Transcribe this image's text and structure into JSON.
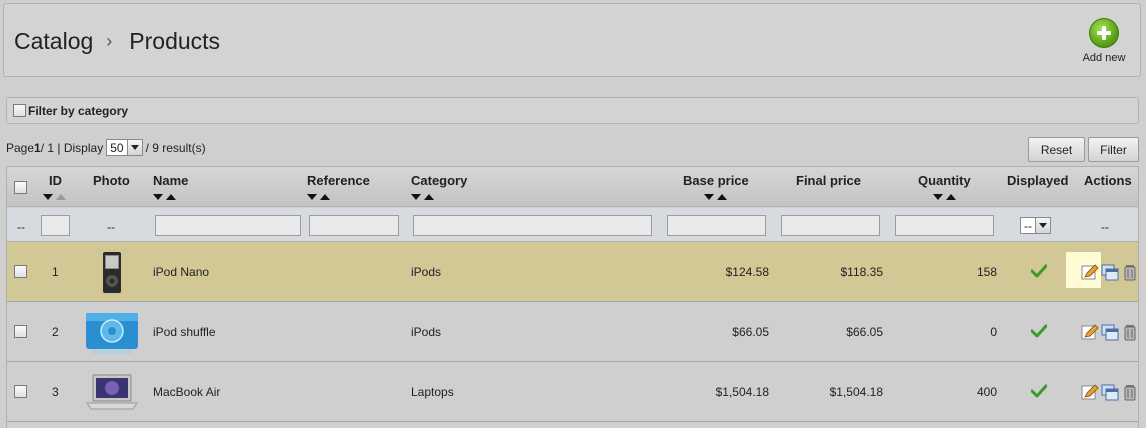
{
  "breadcrumb": {
    "root": "Catalog",
    "separator": "›",
    "current": "Products"
  },
  "toolbar": {
    "add_new_label": "Add new"
  },
  "filter_by_category": {
    "label": "Filter by category"
  },
  "pager": {
    "prefix": "Page ",
    "page": "1",
    "of": " / 1 | Display ",
    "display_value": "50",
    "suffix": " / 9 result(s)"
  },
  "buttons": {
    "reset": "Reset",
    "filter": "Filter"
  },
  "columns": {
    "id": "ID",
    "photo": "Photo",
    "name": "Name",
    "reference": "Reference",
    "category": "Category",
    "base_price": "Base price",
    "final_price": "Final price",
    "quantity": "Quantity",
    "displayed": "Displayed",
    "actions": "Actions"
  },
  "filters": {
    "id_dash": "--",
    "photo_dash": "--",
    "displayed_value": "--",
    "actions_dash": "--"
  },
  "rows": [
    {
      "id": "1",
      "name": "iPod Nano",
      "reference": "",
      "category": "iPods",
      "base_price": "$124.58",
      "final_price": "$118.35",
      "quantity": "158",
      "displayed": "check-icon",
      "highlighted": true
    },
    {
      "id": "2",
      "name": "iPod shuffle",
      "reference": "",
      "category": "iPods",
      "base_price": "$66.05",
      "final_price": "$66.05",
      "quantity": "0",
      "displayed": "check-icon",
      "highlighted": false
    },
    {
      "id": "3",
      "name": "MacBook Air",
      "reference": "",
      "category": "Laptops",
      "base_price": "$1,504.18",
      "final_price": "$1,504.18",
      "quantity": "400",
      "displayed": "check-icon",
      "highlighted": false
    }
  ],
  "colors": {
    "row_highlight": "#d1c895",
    "check_green": "#3a9a2a",
    "add_new_green": "#5aa516"
  }
}
